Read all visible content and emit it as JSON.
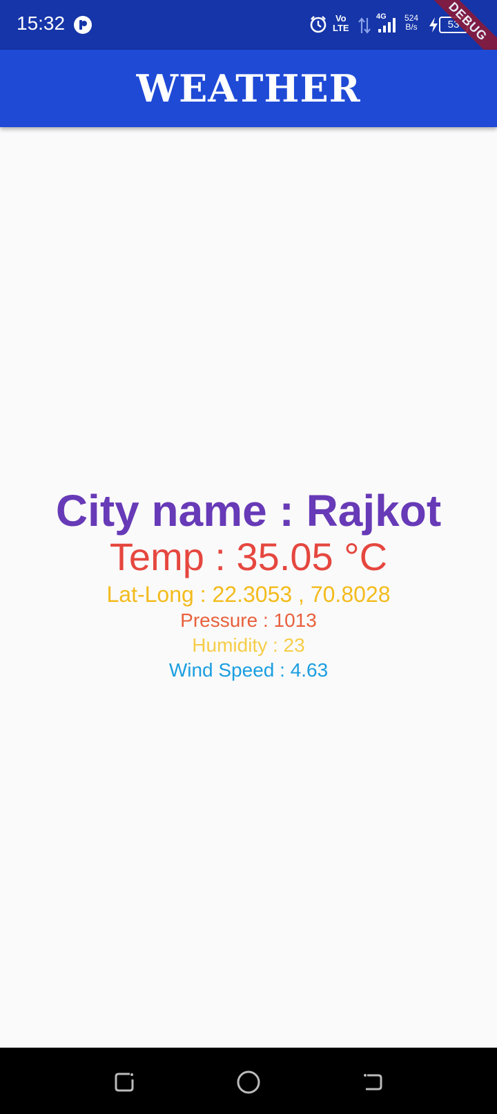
{
  "status_bar": {
    "time": "15:32",
    "network_badge_top": "Vo",
    "network_badge_bottom": "LTE",
    "network_type": "4G",
    "speed_value": "524",
    "speed_unit": "B/s",
    "battery_level": "53",
    "debug_banner": "DEBUG"
  },
  "app_bar": {
    "title": "WEATHER"
  },
  "weather": {
    "city_line": "City name : Rajkot",
    "temp_line": "Temp : 35.05 °C",
    "latlong_line": "Lat-Long : 22.3053 , 70.8028",
    "pressure_line": "Pressure : 1013",
    "humidity_line": "Humidity : 23",
    "wind_line": "Wind Speed : 4.63"
  },
  "colors": {
    "status_bar_bg": "#1535a8",
    "app_bar_bg": "#1f4ad6",
    "city": "#673ab7",
    "temp": "#e5473f",
    "latlong": "#f3bb1c",
    "pressure": "#e8603c",
    "humidity": "#f6cd48",
    "wind": "#1a9ee0"
  },
  "nav_bar": {
    "buttons": [
      "recents-icon",
      "home-icon",
      "back-icon"
    ]
  }
}
